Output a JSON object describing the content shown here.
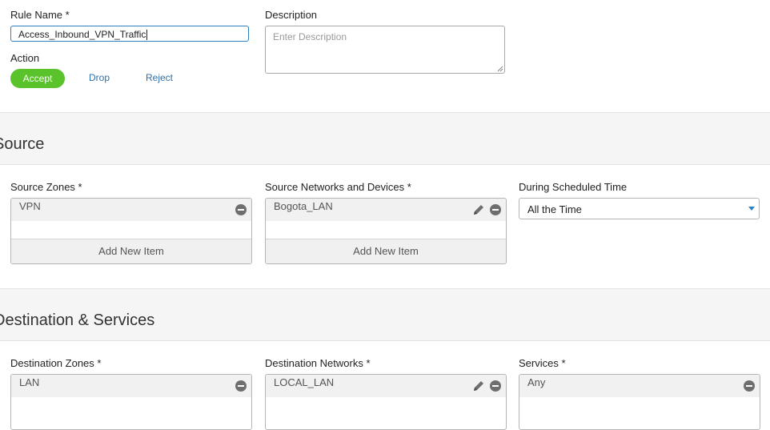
{
  "rule": {
    "name_label": "Rule Name *",
    "name_value": "Access_Inbound_VPN_Traffic",
    "description_label": "Description",
    "description_placeholder": "Enter Description",
    "action_label": "Action",
    "actions": [
      "Accept",
      "Drop",
      "Reject"
    ],
    "selected_action": "Accept"
  },
  "source": {
    "section_title": "Source",
    "zones": {
      "label": "Source Zones *",
      "items": [
        "VPN"
      ],
      "add_label": "Add New Item"
    },
    "networks": {
      "label": "Source Networks and Devices *",
      "items": [
        "Bogota_LAN"
      ],
      "add_label": "Add New Item"
    },
    "schedule": {
      "label": "During Scheduled Time",
      "value": "All the Time"
    }
  },
  "destination": {
    "section_title": "Destination & Services",
    "zones": {
      "label": "Destination Zones *",
      "items": [
        "LAN"
      ]
    },
    "networks": {
      "label": "Destination Networks *",
      "items": [
        "LOCAL_LAN"
      ]
    },
    "services": {
      "label": "Services *",
      "items": [
        "Any"
      ]
    }
  },
  "colors": {
    "accent": "#2b7fc3",
    "accept_green": "#5ac22a",
    "link": "#2d6ea8"
  },
  "icons": [
    "minus-circle-icon",
    "pencil-icon",
    "chevron-down-icon",
    "resize-handle-icon"
  ]
}
